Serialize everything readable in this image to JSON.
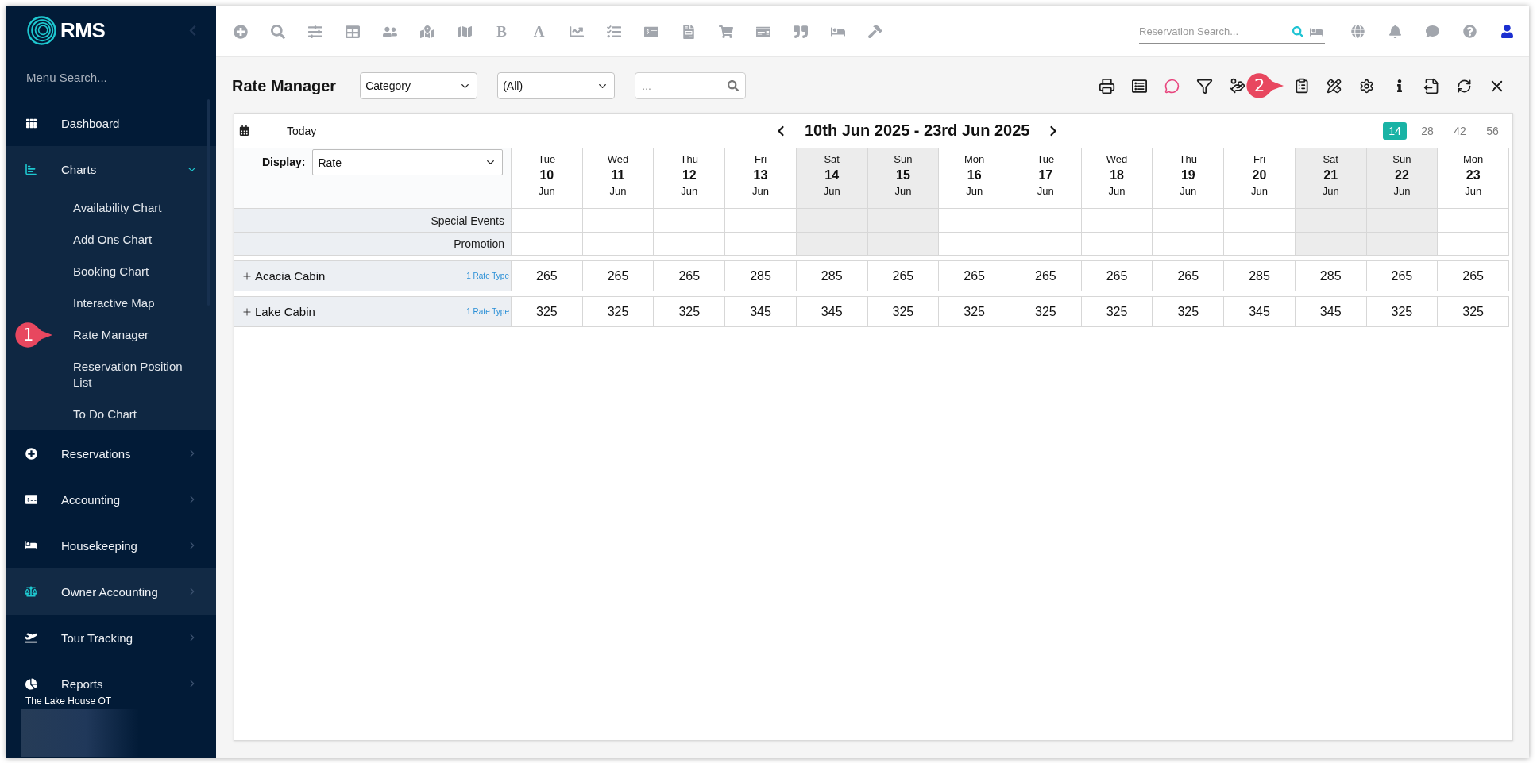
{
  "sidebar": {
    "brand": "RMS",
    "menu_search": {
      "placeholder": "Menu Search..."
    },
    "items": [
      {
        "label": "Dashboard",
        "kind": "link",
        "expanded": false,
        "highlighted": false
      },
      {
        "label": "Charts",
        "kind": "group",
        "expanded": true,
        "highlighted": false,
        "children": [
          {
            "label": "Availability Chart"
          },
          {
            "label": "Add Ons Chart"
          },
          {
            "label": "Booking Chart"
          },
          {
            "label": "Interactive Map"
          },
          {
            "label": "Rate Manager",
            "callout": "1"
          },
          {
            "label": "Reservation Position List"
          },
          {
            "label": "To Do Chart"
          }
        ]
      },
      {
        "label": "Reservations",
        "kind": "group",
        "expanded": false,
        "highlighted": false
      },
      {
        "label": "Accounting",
        "kind": "group",
        "expanded": false,
        "highlighted": false
      },
      {
        "label": "Housekeeping",
        "kind": "group",
        "expanded": false,
        "highlighted": false
      },
      {
        "label": "Owner Accounting",
        "kind": "group",
        "expanded": false,
        "highlighted": true
      },
      {
        "label": "Tour Tracking",
        "kind": "group",
        "expanded": false,
        "highlighted": false
      },
      {
        "label": "Reports",
        "kind": "group",
        "expanded": false,
        "highlighted": false
      }
    ],
    "property": "The Lake House OT"
  },
  "topbar": {
    "glyph_buttons": [
      "B",
      "A"
    ],
    "reservation_search": {
      "placeholder": "Reservation Search..."
    }
  },
  "page": {
    "title": "Rate Manager",
    "filters": [
      {
        "value": "Category"
      },
      {
        "value": "(All)"
      }
    ],
    "search": {
      "placeholder": "..."
    },
    "toolbar_callout": "2"
  },
  "calendar": {
    "today": "Today",
    "range": "10th Jun 2025 - 23rd Jun 2025",
    "spans": [
      {
        "label": "14",
        "selected": true
      },
      {
        "label": "28",
        "selected": false
      },
      {
        "label": "42",
        "selected": false
      },
      {
        "label": "56",
        "selected": false
      }
    ],
    "display": {
      "label": "Display:",
      "value": "Rate"
    },
    "days": [
      {
        "weekday": "Tue",
        "day": "10",
        "month": "Jun",
        "weekend": false
      },
      {
        "weekday": "Wed",
        "day": "11",
        "month": "Jun",
        "weekend": false
      },
      {
        "weekday": "Thu",
        "day": "12",
        "month": "Jun",
        "weekend": false
      },
      {
        "weekday": "Fri",
        "day": "13",
        "month": "Jun",
        "weekend": false
      },
      {
        "weekday": "Sat",
        "day": "14",
        "month": "Jun",
        "weekend": true
      },
      {
        "weekday": "Sun",
        "day": "15",
        "month": "Jun",
        "weekend": true
      },
      {
        "weekday": "Mon",
        "day": "16",
        "month": "Jun",
        "weekend": false
      },
      {
        "weekday": "Tue",
        "day": "17",
        "month": "Jun",
        "weekend": false
      },
      {
        "weekday": "Wed",
        "day": "18",
        "month": "Jun",
        "weekend": false
      },
      {
        "weekday": "Thu",
        "day": "19",
        "month": "Jun",
        "weekend": false
      },
      {
        "weekday": "Fri",
        "day": "20",
        "month": "Jun",
        "weekend": false
      },
      {
        "weekday": "Sat",
        "day": "21",
        "month": "Jun",
        "weekend": true
      },
      {
        "weekday": "Sun",
        "day": "22",
        "month": "Jun",
        "weekend": true
      },
      {
        "weekday": "Mon",
        "day": "23",
        "month": "Jun",
        "weekend": false
      }
    ],
    "info_rows": [
      {
        "label": "Special Events"
      },
      {
        "label": "Promotion"
      }
    ],
    "categories": [
      {
        "name": "Acacia Cabin",
        "rate_types": "1 Rate Type",
        "expanded": false,
        "rates": [
          "265",
          "265",
          "265",
          "285",
          "285",
          "265",
          "265",
          "265",
          "265",
          "265",
          "285",
          "285",
          "265",
          "265"
        ]
      },
      {
        "name": "Lake Cabin",
        "rate_types": "1 Rate Type",
        "expanded": false,
        "rates": [
          "325",
          "325",
          "325",
          "345",
          "345",
          "325",
          "325",
          "325",
          "325",
          "325",
          "345",
          "345",
          "325",
          "325"
        ]
      }
    ]
  }
}
